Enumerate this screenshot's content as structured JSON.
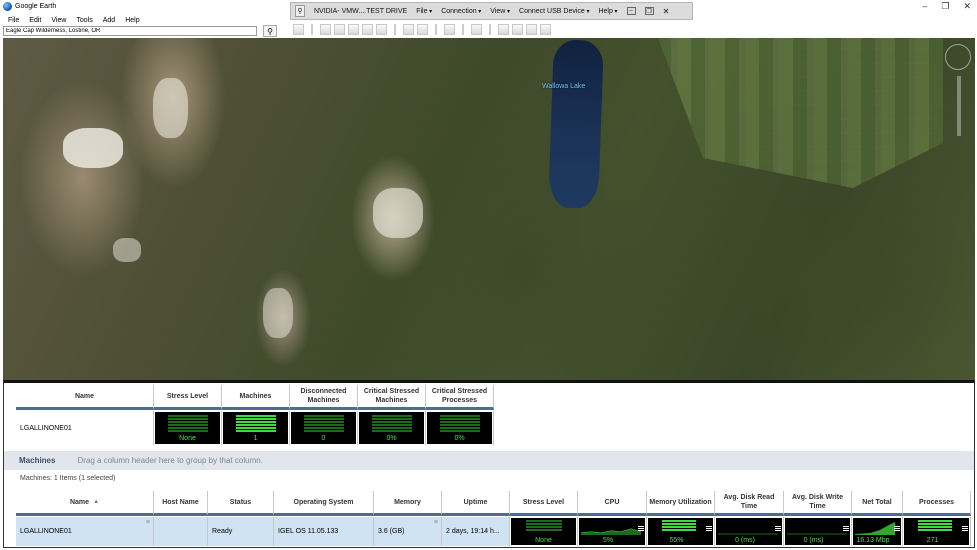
{
  "window": {
    "app_title": "Google Earth"
  },
  "menu": [
    "File",
    "Edit",
    "View",
    "Tools",
    "Add",
    "Help"
  ],
  "vmware": {
    "title": "NVIDIA- VMW....TEST DRIVE",
    "items": [
      "File",
      "Connection",
      "View",
      "Connect USB Device",
      "Help"
    ]
  },
  "search": {
    "value": "Eagle Cap Wilderness, Lostine, OR"
  },
  "map": {
    "label": "Wallowa Lake"
  },
  "summary": {
    "headers": [
      "Name",
      "Stress Level",
      "Machines",
      "Disconnected Machines",
      "Critical Stressed Machines",
      "Critical Stressed Processes"
    ],
    "row": {
      "name": "LGALLINONE01",
      "stress": "None",
      "machines": "1",
      "disconnected": "0",
      "critical_machines": "0%",
      "critical_processes": "0%"
    }
  },
  "group_bar": {
    "title": "Machines",
    "hint": "Drag a column header here to group by that column."
  },
  "items_count": "Machines: 1 Items (1 selected)",
  "machines": {
    "headers": [
      "Name",
      "Host Name",
      "Status",
      "Operating System",
      "Memory",
      "Uptime",
      "Stress Level",
      "CPU",
      "Memory Utilization",
      "Avg. Disk Read Time",
      "Avg. Disk Write Time",
      "Net Total",
      "Processes"
    ],
    "row": {
      "name": "LGALLINONE01",
      "host": "",
      "status": "Ready",
      "os": "IGEL OS 11.05.133",
      "memory": "3.6 (GB)",
      "uptime": "2 days, 19:14 h...",
      "stress": "None",
      "cpu": "5%",
      "mem_util": "55%",
      "disk_read": "0 (ms)",
      "disk_write": "0 (ms)",
      "net_total": "16.13 Mbp",
      "processes": "271"
    }
  },
  "colors": {
    "meter_green": "#43e043",
    "header_underline": "#4d6c8f",
    "selected_row": "#cfe3f4"
  }
}
